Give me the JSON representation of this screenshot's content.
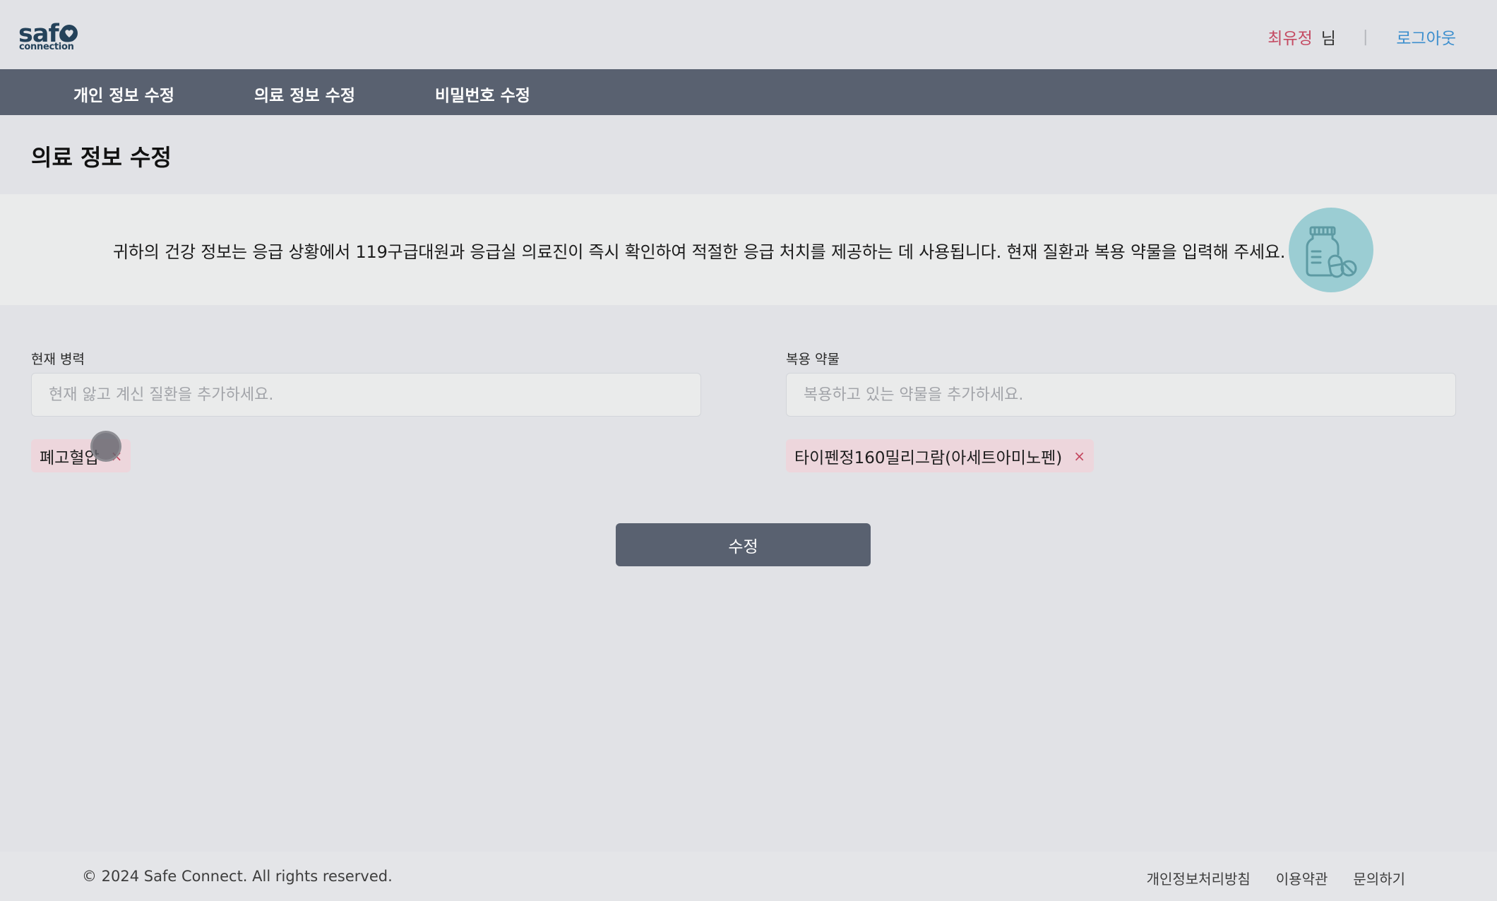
{
  "header": {
    "logo_main": "safe",
    "logo_sub": "connection",
    "user_name": "최유정",
    "user_suffix": "님",
    "divider": "|",
    "logout_label": "로그아웃"
  },
  "nav": {
    "items": [
      {
        "label": "개인 정보 수정"
      },
      {
        "label": "의료 정보 수정"
      },
      {
        "label": "비밀번호 수정"
      }
    ]
  },
  "page": {
    "title": "의료 정보 수정",
    "info_text": "귀하의 건강 정보는 응급 상황에서 119구급대원과 응급실 의료진이 즉시 확인하여 적절한 응급 처치를 제공하는 데 사용됩니다. 현재 질환과 복용 약물을 입력해 주세요."
  },
  "form": {
    "conditions": {
      "label": "현재 병력",
      "placeholder": "현재 앓고 계신 질환을 추가하세요.",
      "value": "",
      "tags": [
        {
          "label": "폐고혈압",
          "remove": "×"
        }
      ]
    },
    "medications": {
      "label": "복용 약물",
      "placeholder": "복용하고 있는 약물을 추가하세요.",
      "value": "",
      "tags": [
        {
          "label": "타이펜정160밀리그람(아세트아미노펜)",
          "remove": "×"
        }
      ]
    },
    "submit_label": "수정"
  },
  "footer": {
    "copyright": "© 2024 Safe Connect. All rights reserved.",
    "links": [
      {
        "label": "개인정보처리방침"
      },
      {
        "label": "이용약관"
      },
      {
        "label": "문의하기"
      }
    ]
  },
  "colors": {
    "nav_bg": "#596170",
    "accent_red": "#c44a62",
    "link_blue": "#3d8fce",
    "tag_bg": "#edd6dc",
    "icon_circle": "#9bcdd3"
  },
  "icons": {
    "logo": "heart-shield-icon",
    "info": "medicine-bottle-icon"
  }
}
